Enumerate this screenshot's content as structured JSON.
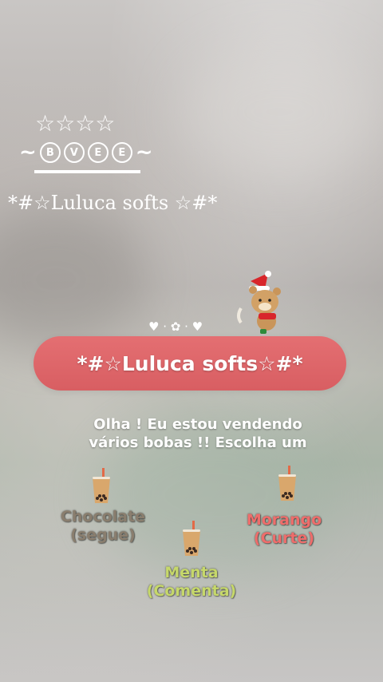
{
  "decor": {
    "stars": "☆☆☆☆",
    "bvee_letters": [
      "B",
      "V",
      "E",
      "E"
    ],
    "tilde": "~",
    "hearts_row": "♥ · ✿ · ♥"
  },
  "brand": {
    "header_line": "*#☆Luluca softs ☆#*",
    "pill_text": "*#☆Luluca softs☆#*"
  },
  "message": {
    "line1": "Olha ! Eu estou vendendo",
    "line2": "vários bobas !! Escolha um"
  },
  "options": [
    {
      "name": "Chocolate",
      "action": "(segue)",
      "color": "#8a7e6e"
    },
    {
      "name": "Morango",
      "action": "(Curte)",
      "color": "#ee6d6b"
    },
    {
      "name": "Menta",
      "action": "(Comenta)",
      "color": "#c6d86a"
    }
  ],
  "colors": {
    "pill": "#dd6468",
    "accent_text": "#ffffff"
  },
  "icons": {
    "cup": "bubble-tea-icon",
    "mascot": "bear-sticker"
  }
}
